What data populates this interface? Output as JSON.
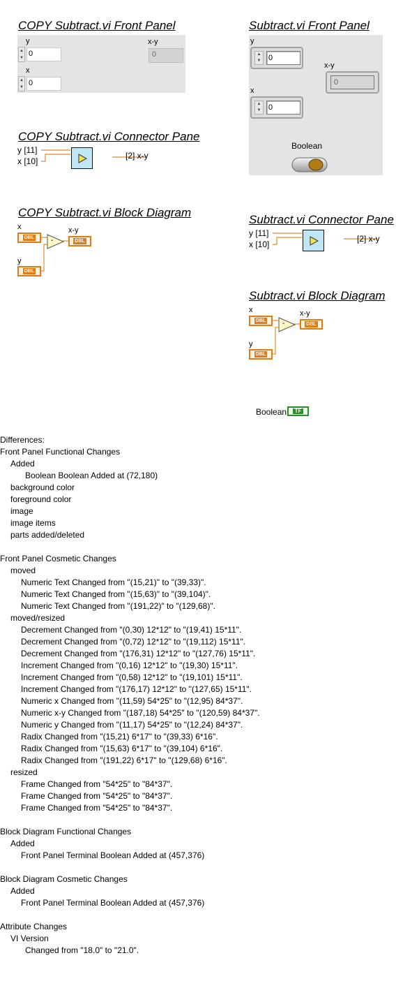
{
  "copy_front_panel": {
    "heading": "COPY  Subtract.vi Front Panel",
    "y_label": "y",
    "y_value": "0",
    "x_label": "x",
    "x_value": "0",
    "xy_label": "x-y",
    "xy_value": "0"
  },
  "front_panel": {
    "heading": "Subtract.vi Front Panel",
    "y_label": "y",
    "y_value": "0",
    "x_label": "x",
    "x_value": "0",
    "xy_label": "x-y",
    "xy_value": "0",
    "boolean_label": "Boolean"
  },
  "copy_connector": {
    "heading": "COPY  Subtract.vi Connector Pane",
    "y_label": "y [11]",
    "x_label": "x [10]",
    "out_label": "[2] x-y"
  },
  "connector": {
    "heading": "Subtract.vi Connector Pane",
    "y_label": "y [11]",
    "x_label": "x [10]",
    "out_label": "[2] x-y"
  },
  "copy_block": {
    "heading": "COPY  Subtract.vi Block Diagram",
    "x_label": "x",
    "y_label": "y",
    "xy_label": "x-y",
    "dbl": "DBL",
    "op": "-"
  },
  "block": {
    "heading": "Subtract.vi Block Diagram",
    "x_label": "x",
    "y_label": "y",
    "xy_label": "x-y",
    "dbl": "DBL",
    "op": "-"
  },
  "boolean_terminal": {
    "label": "Boolean",
    "tf": "TF"
  },
  "colors": {
    "panel_bg": "#e4e4e4",
    "wire": "#e38b29",
    "connector": "#bfe6f4",
    "bool_term": "#2e8b2e"
  },
  "differences": [
    {
      "indent": 0,
      "text": "Differences:"
    },
    {
      "indent": 0,
      "text": "Front Panel Functional Changes"
    },
    {
      "indent": 1,
      "text": "Added"
    },
    {
      "indent": 2,
      "text": "Boolean Boolean Added at (72,180)"
    },
    {
      "indent": 1,
      "text": "background color"
    },
    {
      "indent": 1,
      "text": "foreground color"
    },
    {
      "indent": 1,
      "text": "image"
    },
    {
      "indent": 1,
      "text": "image items"
    },
    {
      "indent": 1,
      "text": "parts added/deleted"
    },
    {
      "indent": 0,
      "text": ""
    },
    {
      "indent": 0,
      "text": "Front Panel Cosmetic Changes"
    },
    {
      "indent": 1,
      "text": "moved"
    },
    {
      "indent": 2,
      "text": "Numeric Text  Changed from \"(15,21)\" to \"(39,33)\"."
    },
    {
      "indent": 2,
      "text": "Numeric Text  Changed from \"(15,63)\" to \"(39,104)\"."
    },
    {
      "indent": 2,
      "text": "Numeric Text  Changed from \"(191,22)\" to \"(129,68)\"."
    },
    {
      "indent": 1,
      "text": "moved/resized"
    },
    {
      "indent": 2,
      "text": "Decrement  Changed from \"(0,30) 12*12\" to \"(19,41) 15*11\"."
    },
    {
      "indent": 2,
      "text": "Decrement  Changed from \"(0,72) 12*12\" to \"(19,112) 15*11\"."
    },
    {
      "indent": 2,
      "text": "Decrement  Changed from \"(176,31) 12*12\" to \"(127,76) 15*11\"."
    },
    {
      "indent": 2,
      "text": "Increment  Changed from \"(0,16) 12*12\" to \"(19,30) 15*11\"."
    },
    {
      "indent": 2,
      "text": "Increment  Changed from \"(0,58) 12*12\" to \"(19,101) 15*11\"."
    },
    {
      "indent": 2,
      "text": "Increment  Changed from \"(176,17) 12*12\" to \"(127,65) 15*11\"."
    },
    {
      "indent": 2,
      "text": "Numeric x Changed from \"(11,59) 54*25\" to \"(12,95) 84*37\"."
    },
    {
      "indent": 2,
      "text": "Numeric x-y Changed from \"(187,18) 54*25\" to \"(120,59) 84*37\"."
    },
    {
      "indent": 2,
      "text": "Numeric y Changed from \"(11,17) 54*25\" to \"(12,24) 84*37\"."
    },
    {
      "indent": 2,
      "text": "Radix  Changed from \"(15,21) 6*17\" to \"(39,33) 6*16\"."
    },
    {
      "indent": 2,
      "text": "Radix  Changed from \"(15,63) 6*17\" to \"(39,104) 6*16\"."
    },
    {
      "indent": 2,
      "text": "Radix  Changed from \"(191,22) 6*17\" to \"(129,68) 6*16\"."
    },
    {
      "indent": 1,
      "text": "resized"
    },
    {
      "indent": 2,
      "text": "Frame  Changed from \"54*25\" to \"84*37\"."
    },
    {
      "indent": 2,
      "text": "Frame  Changed from \"54*25\" to \"84*37\"."
    },
    {
      "indent": 2,
      "text": "Frame  Changed from \"54*25\" to \"84*37\"."
    },
    {
      "indent": 0,
      "text": ""
    },
    {
      "indent": 0,
      "text": "Block Diagram Functional Changes"
    },
    {
      "indent": 1,
      "text": "Added"
    },
    {
      "indent": 2,
      "text": "Front Panel Terminal Boolean Added at (457,376)"
    },
    {
      "indent": 0,
      "text": ""
    },
    {
      "indent": 0,
      "text": "Block Diagram Cosmetic Changes"
    },
    {
      "indent": 1,
      "text": "Added"
    },
    {
      "indent": 2,
      "text": "Front Panel Terminal Boolean Added at (457,376)"
    },
    {
      "indent": 0,
      "text": ""
    },
    {
      "indent": 0,
      "text": "Attribute Changes"
    },
    {
      "indent": 1,
      "text": "VI Version"
    },
    {
      "indent": 2,
      "text": "Changed from \"18.0\" to \"21.0\"."
    }
  ]
}
